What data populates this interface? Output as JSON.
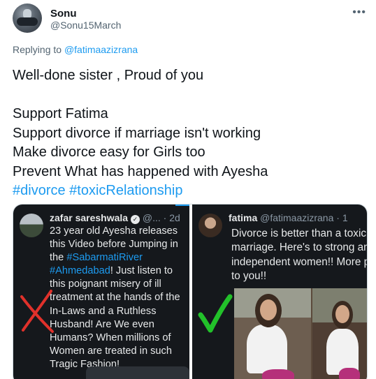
{
  "author": {
    "name": "Sonu",
    "handle": "@Sonu15March"
  },
  "more_label": "•••",
  "replying": {
    "prefix": "Replying to ",
    "handle": "@fatimaazizrana"
  },
  "tweet": {
    "lines": [
      "Well-done sister , Proud of you",
      "",
      "Support Fatima",
      "Support divorce if marriage isn't working",
      "Make divorce easy for Girls too",
      "Prevent What has happened with Ayesha"
    ],
    "hashtags": "#divorce #toxicRelationship"
  },
  "media": {
    "left": {
      "name": "zafar sareshwala",
      "handle": "@...",
      "time": "· 2d",
      "text_before": "23 year old Ayesha releases this Video before Jumping in the ",
      "tag1": "#SabarmatiRiver",
      "tag2": "#Ahmedabad",
      "text_after": "! Just listen to this poignant misery of ill treatment at the hands of the In-Laws and a Ruthless Husband! Are We even Humans? When millions of Women are treated in such Tragic Fashion!",
      "overlay_mark": "cross",
      "overlay_color": "#e0312b"
    },
    "right": {
      "name": "fatima",
      "handle": "@fatimaazizrana",
      "time": "· 1",
      "text": "Divorce is better than a toxic marriage. Here's to strong and independent women!! More power to you!!",
      "overlay_mark": "check",
      "overlay_color": "#22c12a"
    }
  },
  "colors": {
    "link": "#1d9bf0",
    "text": "#0f1419",
    "muted": "#536471",
    "dark_bg": "#15181c"
  }
}
